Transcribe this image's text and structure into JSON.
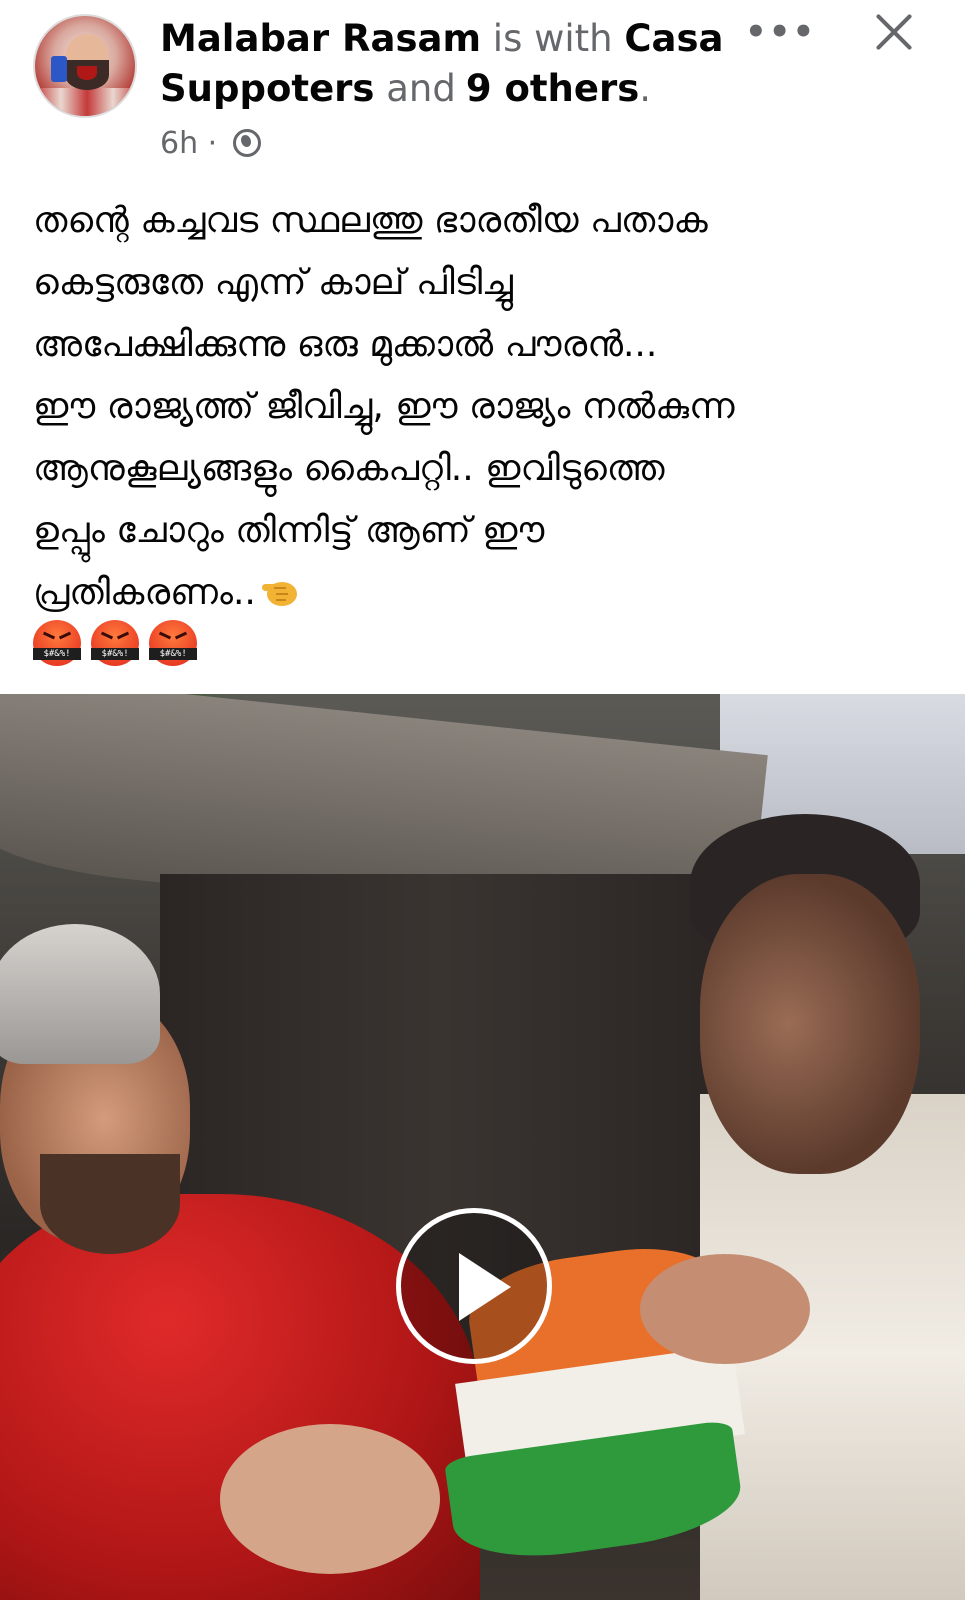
{
  "post": {
    "author": "Malabar Rasam",
    "with_connector": "is with",
    "tagged_name_line1": "Casa",
    "tagged_name_line2": "Suppoters",
    "and_connector": "and",
    "others": "9 others",
    "period": ".",
    "time": "6h",
    "separator": "·",
    "privacy_icon": "globe-icon",
    "text_lines": [
      "തന്റെ കച്ചവട സ്ഥലത്തു ഭാരതീയ പതാക",
      "കെട്ടരുതേ എന്ന് കാല് പിടിച്ചു",
      "അപേക്ഷിക്കുന്നു ഒരു മുക്കാൽ പൗരൻ...",
      "ഈ രാജ്യത്ത് ജീവിച്ചു, ഈ രാജ്യം നൽകുന്ന",
      "ആനുകൂല്യങ്ങളും കൈപറ്റി.. ഇവിടുത്തെ",
      "ഉപ്പും ചോറും തിന്നിട്ട് ആണ് ഈ",
      "പ്രതികരണം.."
    ],
    "angry_emoji_text": "$#&%!",
    "angry_emoji_count": 3
  },
  "icons": {
    "more": "more-options-icon",
    "close": "close-icon",
    "play": "play-icon"
  },
  "colors": {
    "text_primary": "#050505",
    "text_secondary": "#65676b",
    "background": "#ffffff"
  }
}
